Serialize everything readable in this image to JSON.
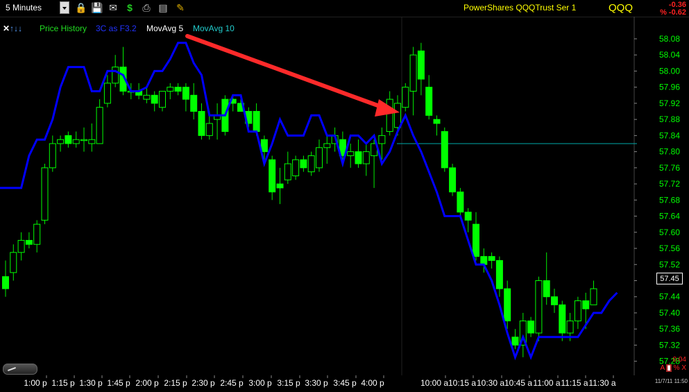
{
  "toolbar": {
    "interval": "5 Minutes",
    "icons": [
      "lock-icon",
      "save-icon",
      "email-icon",
      "dollar-icon",
      "print-icon",
      "export-icon",
      "pencil-icon"
    ]
  },
  "header": {
    "ticker_name": "PowerShares QQQTrust Ser 1",
    "symbol": "QQQ",
    "change": "-0.36",
    "change_pct": "% -0.62"
  },
  "legend": {
    "price_history": "Price History",
    "indicator": "3C as F3.2",
    "ma5": "MovAvg 5",
    "ma10": "MovAvg 10"
  },
  "footer": {
    "right_value": "0.04",
    "timestamp": "11/7/11 11:50"
  },
  "colors": {
    "up": "#00ff00",
    "down": "#00ff00",
    "ma_line": "#0000ff",
    "arrow": "#ff2a2a",
    "hline": "#00aaaa",
    "axis_text": "#00ff00"
  },
  "chart_data": {
    "type": "candlestick",
    "y_ticks": [
      58.08,
      58.04,
      58.0,
      57.96,
      57.92,
      57.88,
      57.84,
      57.8,
      57.76,
      57.72,
      57.68,
      57.64,
      57.6,
      57.56,
      57.52,
      57.48,
      57.44,
      57.4,
      57.36,
      57.32,
      57.28
    ],
    "ylim": [
      57.245,
      58.135
    ],
    "last_price": "57.45",
    "reference_line": 57.82,
    "x_labels": [
      "1:00 p",
      "1:15 p",
      "1:30 p",
      "1:45 p",
      "2:00 p",
      "2:15 p",
      "2:30 p",
      "2:45 p",
      "3:00 p",
      "3:15 p",
      "3:30 p",
      "3:45 p",
      "4:00 p",
      "10:00 a",
      "10:15 a",
      "10:30 a",
      "10:45 a",
      "11:00 a",
      "11:15 a",
      "11:30 a"
    ],
    "candles": [
      {
        "o": 57.46,
        "h": 57.53,
        "l": 57.44,
        "c": 57.49,
        "up": false
      },
      {
        "o": 57.5,
        "h": 57.57,
        "l": 57.48,
        "c": 57.55,
        "up": true
      },
      {
        "o": 57.55,
        "h": 57.6,
        "l": 57.53,
        "c": 57.58,
        "up": true
      },
      {
        "o": 57.58,
        "h": 57.6,
        "l": 57.56,
        "c": 57.57,
        "up": false
      },
      {
        "o": 57.57,
        "h": 57.63,
        "l": 57.55,
        "c": 57.62,
        "up": true
      },
      {
        "o": 57.63,
        "h": 57.77,
        "l": 57.62,
        "c": 57.76,
        "up": true
      },
      {
        "o": 57.76,
        "h": 57.84,
        "l": 57.75,
        "c": 57.82,
        "up": true
      },
      {
        "o": 57.82,
        "h": 57.84,
        "l": 57.8,
        "c": 57.83,
        "up": true
      },
      {
        "o": 57.84,
        "h": 57.85,
        "l": 57.81,
        "c": 57.82,
        "up": false
      },
      {
        "o": 57.82,
        "h": 57.85,
        "l": 57.81,
        "c": 57.83,
        "up": true
      },
      {
        "o": 57.83,
        "h": 57.86,
        "l": 57.8,
        "c": 57.83,
        "up": true
      },
      {
        "o": 57.82,
        "h": 57.87,
        "l": 57.8,
        "c": 57.83,
        "up": true
      },
      {
        "o": 57.82,
        "h": 57.93,
        "l": 57.82,
        "c": 57.91,
        "up": true
      },
      {
        "o": 57.92,
        "h": 57.99,
        "l": 57.91,
        "c": 57.97,
        "up": true
      },
      {
        "o": 57.97,
        "h": 58.04,
        "l": 57.96,
        "c": 58.01,
        "up": true
      },
      {
        "o": 58.01,
        "h": 58.06,
        "l": 57.94,
        "c": 57.95,
        "up": false
      },
      {
        "o": 57.95,
        "h": 57.97,
        "l": 57.93,
        "c": 57.95,
        "up": true
      },
      {
        "o": 57.95,
        "h": 57.97,
        "l": 57.93,
        "c": 57.94,
        "up": false
      },
      {
        "o": 57.94,
        "h": 57.96,
        "l": 57.92,
        "c": 57.93,
        "up": true
      },
      {
        "o": 57.92,
        "h": 57.95,
        "l": 57.9,
        "c": 57.94,
        "up": false
      },
      {
        "o": 57.91,
        "h": 57.95,
        "l": 57.9,
        "c": 57.95,
        "up": true
      },
      {
        "o": 57.95,
        "h": 57.97,
        "l": 57.93,
        "c": 57.96,
        "up": true
      },
      {
        "o": 57.96,
        "h": 57.97,
        "l": 57.94,
        "c": 57.95,
        "up": false
      },
      {
        "o": 57.96,
        "h": 57.97,
        "l": 57.9,
        "c": 57.93,
        "up": false
      },
      {
        "o": 57.94,
        "h": 57.97,
        "l": 57.88,
        "c": 57.9,
        "up": false
      },
      {
        "o": 57.9,
        "h": 57.92,
        "l": 57.83,
        "c": 57.84,
        "up": false
      },
      {
        "o": 57.84,
        "h": 57.9,
        "l": 57.83,
        "c": 57.87,
        "up": true
      },
      {
        "o": 57.88,
        "h": 57.92,
        "l": 57.83,
        "c": 57.89,
        "up": true
      },
      {
        "o": 57.93,
        "h": 57.94,
        "l": 57.84,
        "c": 57.85,
        "up": false
      },
      {
        "o": 57.93,
        "h": 57.94,
        "l": 57.9,
        "c": 57.92,
        "up": false
      },
      {
        "o": 57.92,
        "h": 57.93,
        "l": 57.9,
        "c": 57.9,
        "up": false
      },
      {
        "o": 57.9,
        "h": 57.91,
        "l": 57.86,
        "c": 57.87,
        "up": false
      },
      {
        "o": 57.9,
        "h": 57.92,
        "l": 57.84,
        "c": 57.85,
        "up": false
      },
      {
        "o": 57.83,
        "h": 57.84,
        "l": 57.78,
        "c": 57.8,
        "up": false
      },
      {
        "o": 57.78,
        "h": 57.79,
        "l": 57.68,
        "c": 57.7,
        "up": false
      },
      {
        "o": 57.72,
        "h": 57.76,
        "l": 57.67,
        "c": 57.71,
        "up": false
      },
      {
        "o": 57.73,
        "h": 57.8,
        "l": 57.72,
        "c": 57.77,
        "up": true
      },
      {
        "o": 57.74,
        "h": 57.79,
        "l": 57.73,
        "c": 57.78,
        "up": true
      },
      {
        "o": 57.78,
        "h": 57.79,
        "l": 57.75,
        "c": 57.76,
        "up": false
      },
      {
        "o": 57.75,
        "h": 57.8,
        "l": 57.74,
        "c": 57.79,
        "up": true
      },
      {
        "o": 57.76,
        "h": 57.83,
        "l": 57.75,
        "c": 57.81,
        "up": true
      },
      {
        "o": 57.81,
        "h": 57.84,
        "l": 57.77,
        "c": 57.82,
        "up": true
      },
      {
        "o": 57.82,
        "h": 57.86,
        "l": 57.8,
        "c": 57.84,
        "up": true
      },
      {
        "o": 57.83,
        "h": 57.85,
        "l": 57.78,
        "c": 57.79,
        "up": false
      },
      {
        "o": 57.79,
        "h": 57.82,
        "l": 57.76,
        "c": 57.8,
        "up": true
      },
      {
        "o": 57.8,
        "h": 57.83,
        "l": 57.76,
        "c": 57.77,
        "up": false
      },
      {
        "o": 57.77,
        "h": 57.82,
        "l": 57.74,
        "c": 57.8,
        "up": true
      },
      {
        "o": 57.79,
        "h": 57.83,
        "l": 57.71,
        "c": 57.82,
        "up": true
      },
      {
        "o": 57.82,
        "h": 57.86,
        "l": 57.78,
        "c": 57.84,
        "up": true
      },
      {
        "o": 57.85,
        "h": 57.95,
        "l": 57.84,
        "c": 57.93,
        "up": true
      },
      {
        "o": 57.86,
        "h": 57.94,
        "l": 57.84,
        "c": 57.92,
        "up": true
      },
      {
        "o": 57.91,
        "h": 57.97,
        "l": 57.9,
        "c": 57.96,
        "up": true
      },
      {
        "o": 57.95,
        "h": 58.06,
        "l": 57.89,
        "c": 58.04,
        "up": true
      },
      {
        "o": 58.05,
        "h": 58.07,
        "l": 57.94,
        "c": 57.98,
        "up": false
      },
      {
        "o": 57.96,
        "h": 57.99,
        "l": 57.88,
        "c": 57.89,
        "up": false
      },
      {
        "o": 57.88,
        "h": 57.89,
        "l": 57.84,
        "c": 57.87,
        "up": false
      },
      {
        "o": 57.85,
        "h": 57.86,
        "l": 57.75,
        "c": 57.76,
        "up": false
      },
      {
        "o": 57.76,
        "h": 57.77,
        "l": 57.69,
        "c": 57.7,
        "up": false
      },
      {
        "o": 57.7,
        "h": 57.71,
        "l": 57.64,
        "c": 57.65,
        "up": false
      },
      {
        "o": 57.65,
        "h": 57.66,
        "l": 57.6,
        "c": 57.63,
        "up": false
      },
      {
        "o": 57.62,
        "h": 57.65,
        "l": 57.53,
        "c": 57.54,
        "up": false
      },
      {
        "o": 57.54,
        "h": 57.56,
        "l": 57.5,
        "c": 57.52,
        "up": false
      },
      {
        "o": 57.53,
        "h": 57.55,
        "l": 57.51,
        "c": 57.54,
        "up": false
      },
      {
        "o": 57.53,
        "h": 57.54,
        "l": 57.44,
        "c": 57.46,
        "up": false
      },
      {
        "o": 57.46,
        "h": 57.48,
        "l": 57.36,
        "c": 57.38,
        "up": false
      },
      {
        "o": 57.34,
        "h": 57.36,
        "l": 57.31,
        "c": 57.32,
        "up": false
      },
      {
        "o": 57.32,
        "h": 57.4,
        "l": 57.29,
        "c": 57.38,
        "up": true
      },
      {
        "o": 57.38,
        "h": 57.39,
        "l": 57.34,
        "c": 57.35,
        "up": false
      },
      {
        "o": 57.35,
        "h": 57.49,
        "l": 57.33,
        "c": 57.48,
        "up": true
      },
      {
        "o": 57.48,
        "h": 57.55,
        "l": 57.42,
        "c": 57.44,
        "up": false
      },
      {
        "o": 57.44,
        "h": 57.46,
        "l": 57.4,
        "c": 57.42,
        "up": false
      },
      {
        "o": 57.42,
        "h": 57.43,
        "l": 57.33,
        "c": 57.35,
        "up": false
      },
      {
        "o": 57.35,
        "h": 57.4,
        "l": 57.33,
        "c": 57.38,
        "up": true
      },
      {
        "o": 57.38,
        "h": 57.44,
        "l": 57.36,
        "c": 57.43,
        "up": true
      },
      {
        "o": 57.43,
        "h": 57.45,
        "l": 57.36,
        "c": 57.41,
        "up": false
      },
      {
        "o": 57.42,
        "h": 57.48,
        "l": 57.42,
        "c": 57.46,
        "up": true
      }
    ],
    "ma5": [
      57.71,
      57.71,
      57.71,
      57.79,
      57.83,
      57.83,
      57.88,
      57.96,
      58.01,
      58.01,
      58.01,
      57.95,
      57.95,
      58.0,
      58.0,
      57.99,
      57.95,
      57.95,
      57.96,
      58.0,
      58.0,
      58.03,
      58.07,
      58.07,
      58.02,
      57.99,
      57.89,
      57.89,
      57.89,
      57.94,
      57.94,
      57.85,
      57.85,
      57.77,
      57.82,
      57.88,
      57.84,
      57.84,
      57.84,
      57.89,
      57.89,
      57.84,
      57.84,
      57.77,
      57.84,
      57.84,
      57.82,
      57.84,
      57.77,
      57.8,
      57.85,
      57.89,
      57.84,
      57.8,
      57.75,
      57.7,
      57.64,
      57.64,
      57.64,
      57.58,
      57.52,
      57.52,
      57.48,
      57.42,
      57.35,
      57.29,
      57.34,
      57.29,
      57.34,
      57.34,
      57.34,
      57.34,
      57.34,
      57.34,
      57.37,
      57.4,
      57.4,
      57.43,
      57.45
    ]
  }
}
